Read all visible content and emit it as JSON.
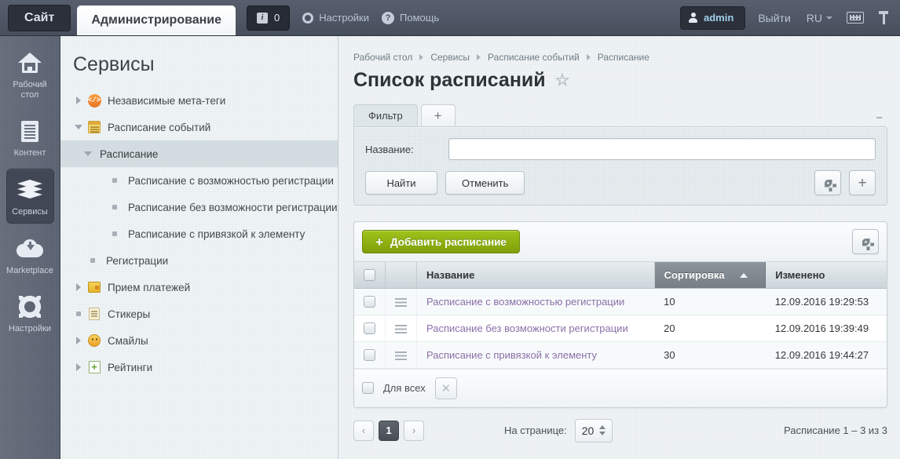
{
  "topbar": {
    "site_label": "Сайт",
    "admin_label": "Администрирование",
    "notif_icon": "info-icon",
    "notif_count": "0",
    "settings_icon": "gear-icon",
    "settings_label": "Настройки",
    "help_icon": "question-icon",
    "help_label": "Помощь",
    "user_icon": "person-icon",
    "user_label": "admin",
    "logout_label": "Выйти",
    "lang_label": "RU",
    "keyboard_icon": "keyboard-icon",
    "pin_icon": "pin-icon"
  },
  "rail": {
    "items": [
      {
        "label": "Рабочий\nстол",
        "icon": "home-icon",
        "active": false
      },
      {
        "label": "Контент",
        "icon": "document-icon",
        "active": false
      },
      {
        "label": "Сервисы",
        "icon": "layers-icon",
        "active": true
      },
      {
        "label": "Marketplace",
        "icon": "cloud-download-icon",
        "active": false
      },
      {
        "label": "Настройки",
        "icon": "gear-icon",
        "active": false
      }
    ]
  },
  "tree": {
    "title": "Сервисы",
    "items": [
      {
        "label": "Независимые мета-теги",
        "icon": "code-icon",
        "toggle": "collapsed",
        "level": 1,
        "selected": false
      },
      {
        "label": "Расписание событий",
        "icon": "schedule-icon",
        "toggle": "expanded",
        "level": 1,
        "selected": false
      },
      {
        "label": "Расписание",
        "icon": "none",
        "toggle": "expanded",
        "level": 2,
        "selected": true
      },
      {
        "label": "Расписание с возможностью регистрации",
        "icon": "none",
        "toggle": "bullet",
        "level": 3,
        "selected": false
      },
      {
        "label": "Расписание без возможности регистрации",
        "icon": "none",
        "toggle": "bullet",
        "level": 3,
        "selected": false
      },
      {
        "label": "Расписание с привязкой к элементу",
        "icon": "none",
        "toggle": "bullet",
        "level": 3,
        "selected": false
      },
      {
        "label": "Регистрации",
        "icon": "none",
        "toggle": "bullet",
        "level": 2,
        "selected": false
      },
      {
        "label": "Прием платежей",
        "icon": "wallet-icon",
        "toggle": "collapsed",
        "level": 1,
        "selected": false
      },
      {
        "label": "Стикеры",
        "icon": "sticker-icon",
        "toggle": "bullet",
        "level": 1,
        "selected": false
      },
      {
        "label": "Смайлы",
        "icon": "smile-icon",
        "toggle": "collapsed",
        "level": 1,
        "selected": false
      },
      {
        "label": "Рейтинги",
        "icon": "rating-icon",
        "toggle": "collapsed",
        "level": 1,
        "selected": false
      }
    ]
  },
  "breadcrumb": [
    "Рабочий стол",
    "Сервисы",
    "Расписание событий",
    "Расписание"
  ],
  "page": {
    "title": "Список расписаний",
    "favorite_icon": "star-icon"
  },
  "filter": {
    "tab_label": "Фильтр",
    "add_tab_label": "+",
    "collapse_label": "−",
    "field_label": "Название:",
    "field_value": "",
    "field_placeholder": "",
    "search_label": "Найти",
    "cancel_label": "Отменить",
    "settings_icon": "gear-icon",
    "add_icon": "plus-icon"
  },
  "grid": {
    "add_label": "Добавить расписание",
    "add_icon": "plus-icon",
    "settings_icon": "gear-icon",
    "columns": [
      "Название",
      "Сортировка",
      "Изменено"
    ],
    "sorted_column": "Сортировка",
    "sort_direction": "asc",
    "rows": [
      {
        "name": "Расписание с возможностью регистрации",
        "sort": "10",
        "modified": "12.09.2016 19:29:53"
      },
      {
        "name": "Расписание без возможности регистрации",
        "sort": "20",
        "modified": "12.09.2016 19:39:49"
      },
      {
        "name": "Расписание с привязкой к элементу",
        "sort": "30",
        "modified": "12.09.2016 19:44:27"
      }
    ],
    "select_all_label": "Для всех",
    "clear_icon": "close-icon"
  },
  "pager": {
    "prev_label": "‹",
    "current_page": "1",
    "next_label": "›",
    "per_page_label": "На странице:",
    "per_page_value": "20",
    "summary": "Расписание 1 – 3 из 3"
  },
  "colors": {
    "topbar_bg": "#4a5160",
    "rail_bg": "#5d6472",
    "accent_green": "#8aad10",
    "link_purple": "#8b6fa8",
    "panel_bg": "#e9eef0"
  }
}
